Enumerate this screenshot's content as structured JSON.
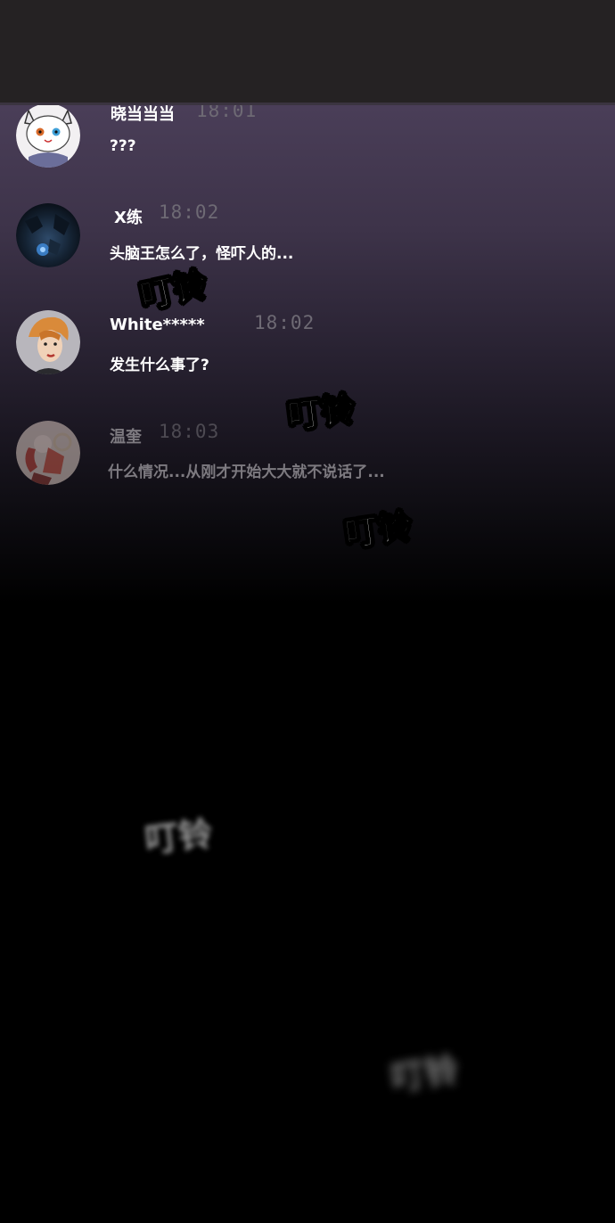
{
  "messages": [
    {
      "name": "晓当当当",
      "time": "18:01",
      "text": "???",
      "avatar_icon": "white-cat-avatar-icon"
    },
    {
      "name": "X练",
      "time": "18:02",
      "text": "头脑王怎么了，怪吓人的...",
      "avatar_icon": "dark-cave-avatar-icon"
    },
    {
      "name": "White*****",
      "time": "18:02",
      "text": "发生什么事了?",
      "avatar_icon": "orange-hair-woman-avatar-icon"
    },
    {
      "name": "温奎",
      "time": "18:03",
      "text": "什么情况...从刚才开始大大就不说话了...",
      "avatar_icon": "red-figure-avatar-icon"
    }
  ],
  "sound_effects": [
    "叮铃",
    "叮铃",
    "叮铃",
    "叮铃",
    "叮铃"
  ],
  "colors": {
    "top_bar": "#252223",
    "panel_top": "#4a3e58",
    "background": "#000000",
    "text": "#ffffff",
    "time": "#6e6a74"
  }
}
